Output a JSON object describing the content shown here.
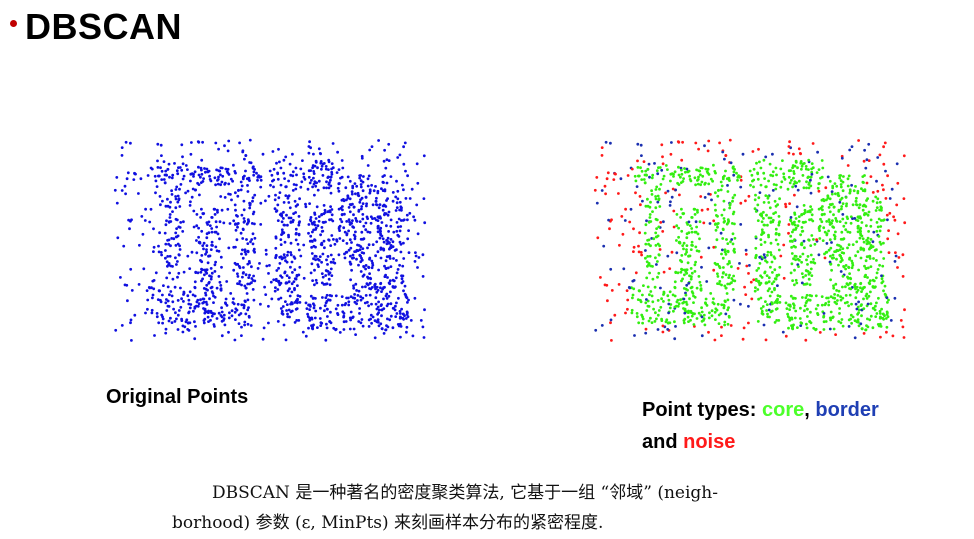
{
  "title": "DBSCAN",
  "captions": {
    "original": "Original Points",
    "types_prefix": "Point types: ",
    "core": "core",
    "sep1": ", ",
    "border": "border",
    "and": "and ",
    "noise": "noise"
  },
  "description": {
    "line1": "DBSCAN 是一种著名的密度聚类算法, 它基于一组 “邻域” (neigh-",
    "line2": "borhood) 参数 (ε, MinPts) 来刻画样本分布的紧密程度."
  },
  "colors": {
    "original_points": "#1010e0",
    "core": "#33ee11",
    "border": "#1a2fb0",
    "noise": "#ff1a1a",
    "bullet": "#c00000"
  }
}
